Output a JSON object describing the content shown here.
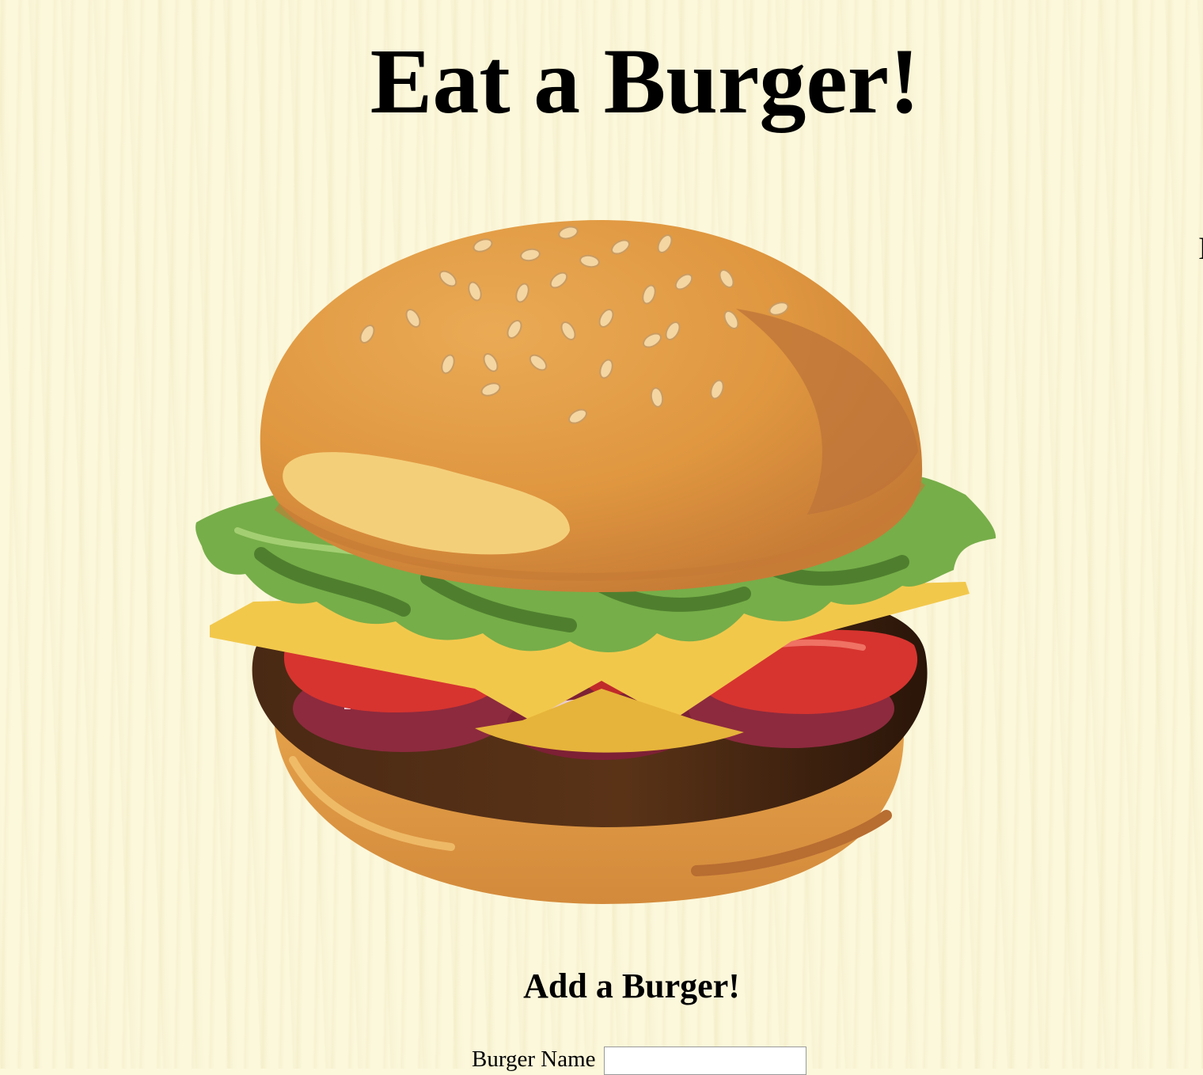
{
  "page": {
    "title": "Eat a Burger!",
    "edge_glyph": "I"
  },
  "illustration": {
    "icon": "burger-icon",
    "colors": {
      "bun": "#e09c47",
      "bun_shadow": "#bd7439",
      "bun_highlight": "#f4cf7a",
      "seed": "#f4d6a3",
      "lettuce": "#76ae49",
      "lettuce_dark": "#3e6b23",
      "cheese": "#f2c84b",
      "tomato": "#d7342f",
      "onion": "#8d2a3e",
      "patty": "#4b2a14"
    }
  },
  "add_form": {
    "title": "Add a Burger!",
    "name_label": "Burger Name",
    "name_value": "",
    "name_placeholder": ""
  },
  "colors": {
    "background": "#fcf8dc",
    "text": "#000000"
  }
}
